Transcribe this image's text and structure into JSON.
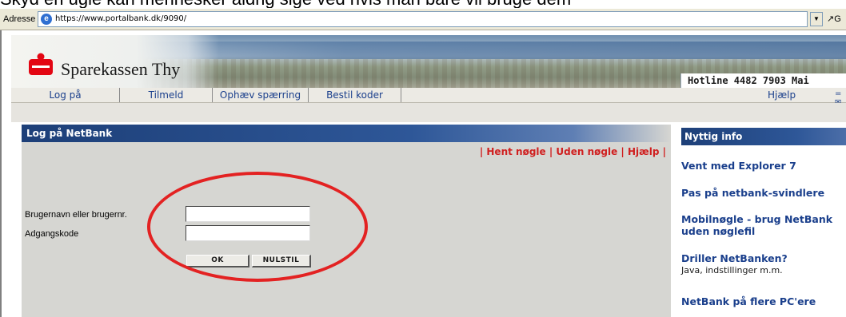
{
  "caption": "Skyd en ugle kan mennesker aldrig sige ved hvis man bare vil bruge dem",
  "address_bar": {
    "label": "Adresse",
    "url": "https://www.portalbank.dk/9090/",
    "go_label": "G"
  },
  "header": {
    "bank_name": "Sparekassen Thy",
    "hotline": "Hotline 4482 7903  Mai"
  },
  "nav": {
    "items": [
      {
        "label": "Log på"
      },
      {
        "label": "Tilmeld"
      },
      {
        "label": "Ophæv spærring"
      },
      {
        "label": "Bestil koder"
      }
    ],
    "help": "Hjælp"
  },
  "login": {
    "title": "Log på NetBank",
    "links": [
      "Hent nøgle",
      "Uden nøgle",
      "Hjælp"
    ],
    "username_label": "Brugernavn eller brugernr.",
    "password_label": "Adgangskode",
    "username_value": "",
    "password_value": "",
    "ok_label": "OK",
    "reset_label": "NULSTIL"
  },
  "sidebar": {
    "title": "Nyttig info",
    "items": [
      {
        "label": "Vent med Explorer 7",
        "sub": ""
      },
      {
        "label": "Pas på netbank-svindlere",
        "sub": ""
      },
      {
        "label": "Mobilnøgle - brug NetBank uden nøglefil",
        "sub": ""
      },
      {
        "label": "Driller NetBanken?",
        "sub": "Java, indstillinger m.m."
      },
      {
        "label": "NetBank på flere PC'ere",
        "sub": ""
      }
    ]
  },
  "colors": {
    "header_blue": "#1d3f78",
    "link_blue": "#1a3f8c",
    "link_red": "#d02020",
    "annotation_red": "#e32222"
  }
}
